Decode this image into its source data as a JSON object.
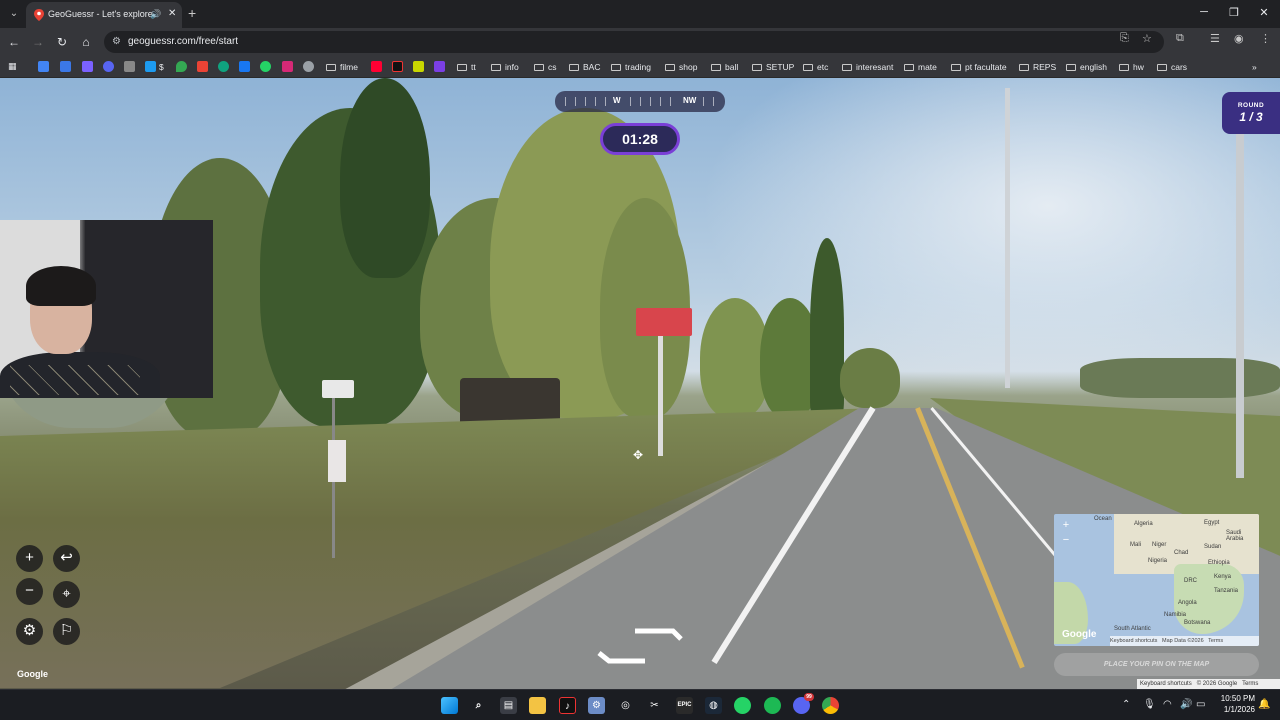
{
  "browser": {
    "tab": {
      "title": "GeoGuessr - Let's explore the world!",
      "favicon": "map-pin-icon"
    },
    "url": "geoguessr.com/free/start",
    "bookmarks": {
      "icon_items": [
        "tab-search-icon",
        "google-icon",
        "docs-icon",
        "discord-icon",
        "extension-icon",
        "x-icon",
        "dollar-icon",
        "maps-icon",
        "gmail-icon",
        "chatgpt-icon",
        "facebook-icon",
        "whatsapp-icon",
        "instagram-icon",
        "settings-icon"
      ],
      "dollar_label": "$",
      "filme": "filme",
      "folders": [
        "tt",
        "info",
        "cs",
        "BAC",
        "trading",
        "shop",
        "ball",
        "SETUP",
        "etc",
        "interesant",
        "mate",
        "pt facultate",
        "REPS",
        "english",
        "hw",
        "cars"
      ]
    }
  },
  "game": {
    "compass": {
      "primary": "W",
      "secondary": "NW"
    },
    "timer": "01:28",
    "round_label": "ROUND",
    "round_value": "1 / 3",
    "google_attrib": "Google",
    "place_pin": "PLACE YOUR PIN ON THE MAP",
    "bottom_attrib": [
      "Keyboard shortcuts",
      "© 2026 Google",
      "Terms"
    ]
  },
  "minimap": {
    "labels": [
      {
        "text": "Algeria"
      },
      {
        "text": "Egypt"
      },
      {
        "text": "Saudi Arabia"
      },
      {
        "text": "Mali"
      },
      {
        "text": "Niger"
      },
      {
        "text": "Sudan"
      },
      {
        "text": "Chad"
      },
      {
        "text": "Nigeria"
      },
      {
        "text": "Ethiopia"
      },
      {
        "text": "Kenya"
      },
      {
        "text": "DRC"
      },
      {
        "text": "Tanzania"
      },
      {
        "text": "Angola"
      },
      {
        "text": "Namibia"
      },
      {
        "text": "Botswana"
      },
      {
        "text": "Ocean"
      },
      {
        "text": "South Atlantic"
      }
    ],
    "google": "Google",
    "footer": [
      "Keyboard shortcuts",
      "Map Data ©2026",
      "Terms"
    ]
  },
  "taskbar": {
    "apps": [
      "windows-start-icon",
      "search-icon",
      "calculator-icon",
      "file-explorer-icon",
      "tiktok-icon",
      "settings-icon",
      "steam-helper-icon",
      "capcut-icon",
      "epic-games-icon",
      "steam-icon",
      "whatsapp-icon",
      "spotify-icon",
      "discord-icon",
      "chrome-icon"
    ],
    "epic_label": "EPIC",
    "discord_badge": "99",
    "time": "10:50 PM",
    "date": "1/1/2026"
  }
}
